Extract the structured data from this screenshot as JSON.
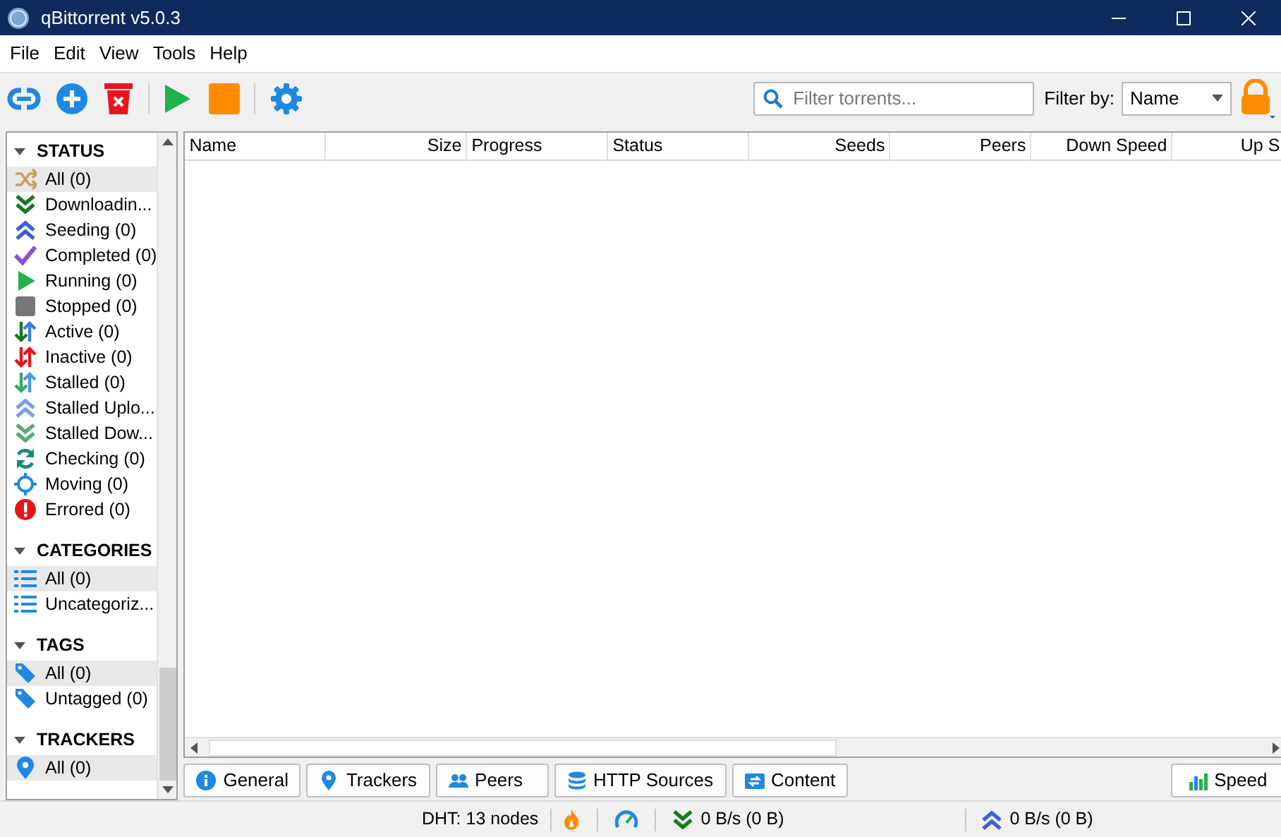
{
  "window": {
    "title": "qBittorrent v5.0.3"
  },
  "menu": [
    "File",
    "Edit",
    "View",
    "Tools",
    "Help"
  ],
  "toolbar": {
    "search": {
      "placeholder": "Filter torrents..."
    },
    "filter_label": "Filter by:",
    "filter_value": "Name"
  },
  "sidebar": [
    {
      "title": "STATUS",
      "expanded": true,
      "items": [
        {
          "kind": "all",
          "label": "All (0)",
          "selected": true
        },
        {
          "kind": "downloading",
          "label": "Downloadin...",
          "selected": false
        },
        {
          "kind": "seeding",
          "label": "Seeding (0)",
          "selected": false
        },
        {
          "kind": "completed",
          "label": "Completed (0)",
          "selected": false
        },
        {
          "kind": "running",
          "label": "Running (0)",
          "selected": false
        },
        {
          "kind": "stopped",
          "label": "Stopped (0)",
          "selected": false
        },
        {
          "kind": "active",
          "label": "Active (0)",
          "selected": false
        },
        {
          "kind": "inactive",
          "label": "Inactive (0)",
          "selected": false
        },
        {
          "kind": "stalled",
          "label": "Stalled (0)",
          "selected": false
        },
        {
          "kind": "stalled_up",
          "label": "Stalled Uplo...",
          "selected": false
        },
        {
          "kind": "stalled_down",
          "label": "Stalled Dow...",
          "selected": false
        },
        {
          "kind": "checking",
          "label": "Checking (0)",
          "selected": false
        },
        {
          "kind": "moving",
          "label": "Moving (0)",
          "selected": false
        },
        {
          "kind": "errored",
          "label": "Errored (0)",
          "selected": false
        }
      ]
    },
    {
      "title": "CATEGORIES",
      "expanded": true,
      "items": [
        {
          "kind": "category",
          "label": "All (0)",
          "selected": true
        },
        {
          "kind": "category",
          "label": "Uncategoriz...",
          "selected": false
        }
      ]
    },
    {
      "title": "TAGS",
      "expanded": true,
      "items": [
        {
          "kind": "tag",
          "label": "All (0)",
          "selected": true
        },
        {
          "kind": "tag",
          "label": "Untagged (0)",
          "selected": false
        }
      ]
    },
    {
      "title": "TRACKERS",
      "expanded": true,
      "items": [
        {
          "kind": "tracker",
          "label": "All (0)",
          "selected": true
        }
      ]
    }
  ],
  "table": {
    "columns": [
      {
        "label": "Name",
        "kind": "text"
      },
      {
        "label": "Size",
        "kind": "number"
      },
      {
        "label": "Progress",
        "kind": "text"
      },
      {
        "label": "Status",
        "kind": "text"
      },
      {
        "label": "Seeds",
        "kind": "number"
      },
      {
        "label": "Peers",
        "kind": "number"
      },
      {
        "label": "Down Speed",
        "kind": "number"
      },
      {
        "label": "Up S",
        "kind": "number"
      }
    ]
  },
  "bottom_tabs": [
    {
      "kind": "general",
      "label": "General"
    },
    {
      "kind": "trackers",
      "label": "Trackers"
    },
    {
      "kind": "peers",
      "label": "Peers"
    },
    {
      "kind": "http",
      "label": "HTTP Sources"
    },
    {
      "kind": "content",
      "label": "Content"
    }
  ],
  "speed_button": "Speed",
  "status_bar": {
    "dht": "DHT: 13 nodes",
    "download": "0 B/s (0 B)",
    "upload": "0 B/s (0 B)"
  }
}
